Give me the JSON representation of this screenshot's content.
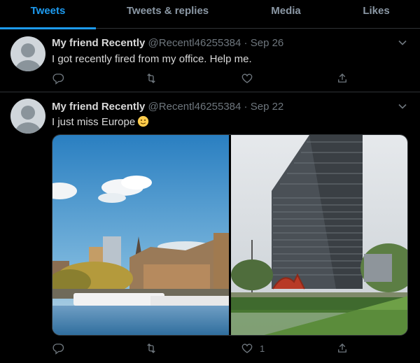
{
  "tabs": [
    {
      "label": "Tweets",
      "active": true
    },
    {
      "label": "Tweets & replies",
      "active": false
    },
    {
      "label": "Media",
      "active": false
    },
    {
      "label": "Likes",
      "active": false
    }
  ],
  "tweets": [
    {
      "name": "My friend Recently",
      "handle": "@Recentl46255384",
      "dot": "·",
      "date": "Sep 26",
      "text": "I got recently fired from my office. Help me.",
      "like_count": ""
    },
    {
      "name": "My friend Recently",
      "handle": "@Recentl46255384",
      "dot": "·",
      "date": "Sep 22",
      "text": "I just miss Europe",
      "emoji": "slightly-smiling-face-icon",
      "media": [
        "city-river-skyline-photo",
        "office-tower-photo"
      ],
      "like_count": "1"
    }
  ],
  "colors": {
    "accent": "#1d9bf0",
    "background": "#000000",
    "muted_text": "#6e767d",
    "divider": "#2f3336"
  }
}
